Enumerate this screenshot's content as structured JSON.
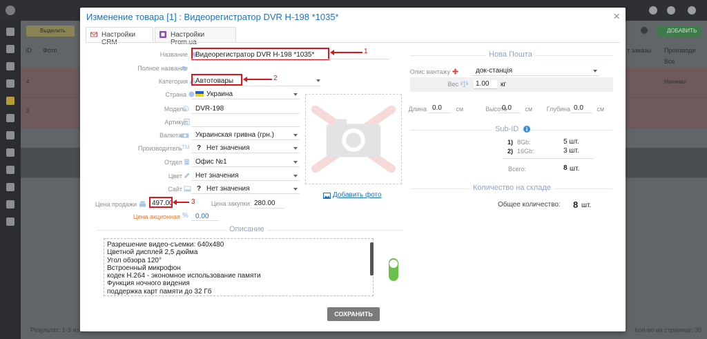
{
  "background": {
    "filter_label": "Выделить",
    "add_label": "ДОБАВИТЬ",
    "columns": {
      "id": "ID",
      "photo": "Фото",
      "orders": "т заказы",
      "manufacturer": "Производи",
      "manufacturer_filter": "Все"
    },
    "rows": [
      {
        "num": "4",
        "tag": "Начинал"
      },
      {
        "num": "3",
        "tag": ""
      }
    ],
    "footer_left": "Результат: 1-3 из 3",
    "footer_right": "Кол-во на странице: 30"
  },
  "modal": {
    "title": "Изменение товара [1] : Видеорегистратор DVR H-198 *1035*",
    "close_label": "×",
    "tabs": [
      {
        "label": "Настройки CRM",
        "active": true
      },
      {
        "label": "Настройки Prom.ua",
        "active": false
      }
    ],
    "fields": {
      "name_label": "Название",
      "name_value": "Видеорегистратор DVR H-198 *1035*",
      "full_name_label": "Полное название",
      "category_label": "Категория",
      "category_value": "Автотовары",
      "country_label": "Страна",
      "country_value": "Украина",
      "model_label": "Модель",
      "model_value": "DVR-198",
      "article_label": "Артикул",
      "currency_label": "Валюта",
      "currency_value": "Украинская гривна (грн.)",
      "manufacturer_label": "Производитель",
      "manufacturer_value": "Нет значения",
      "department_label": "Отдел",
      "department_value": "Офис №1",
      "color_label": "Цвет",
      "color_value": "Нет значения",
      "site_label": "Сайт",
      "site_value": "Нет значения",
      "sale_price_label": "Цена продажи",
      "sale_price_value": "497.00",
      "purchase_price_label": "Цена закупки:",
      "purchase_price_value": "280.00",
      "promo_price_label": "Цена акционная",
      "promo_price_value": "0.00",
      "unknown_mark": "?"
    },
    "annotations": {
      "n1": "1",
      "n2": "2",
      "n3": "3"
    },
    "photo": {
      "add_label": "Добавить фото"
    },
    "description": {
      "title": "Описание",
      "lines": [
        "Разрешение видео-съемки: 640х480",
        "Цветной дисплей 2,5 дюйма",
        "Угол обзора 120°",
        "Встроенный микрофон",
        "кодек H.264 - экономное использование памяти",
        "Функция ночного видения",
        "поддержка карт памяти до 32 Гб"
      ]
    },
    "nova_poshta": {
      "title": "Нова Пошта",
      "cargo_label": "Опис вантажу",
      "cargo_value": "док-станція",
      "weight_label": "Вес",
      "weight_value": "1.00",
      "weight_unit": "кг",
      "length_label": "Длина",
      "length_value": "0.0",
      "height_label": "Высота",
      "height_value": "0.0",
      "depth_label": "Глубина",
      "depth_value": "0.0",
      "dim_unit": "см"
    },
    "sub_id": {
      "title": "Sub-ID",
      "rows": [
        {
          "idx": "1)",
          "name": "8Gb:",
          "qty": "5 шт."
        },
        {
          "idx": "2)",
          "name": "16Gb:",
          "qty": "3 шт."
        }
      ],
      "total_label": "Всего:",
      "total_value": "8",
      "total_unit": "шт."
    },
    "stock": {
      "title": "Количество на складе",
      "total_label": "Общее количество:",
      "total_value": "8",
      "total_unit": "шт."
    },
    "save_label": "СОХРАНИТЬ"
  },
  "colors": {
    "accent": "#1e73be",
    "annotation": "#e0141d",
    "section_title": "#93a3c0",
    "toggle_on": "#6cc04a"
  }
}
